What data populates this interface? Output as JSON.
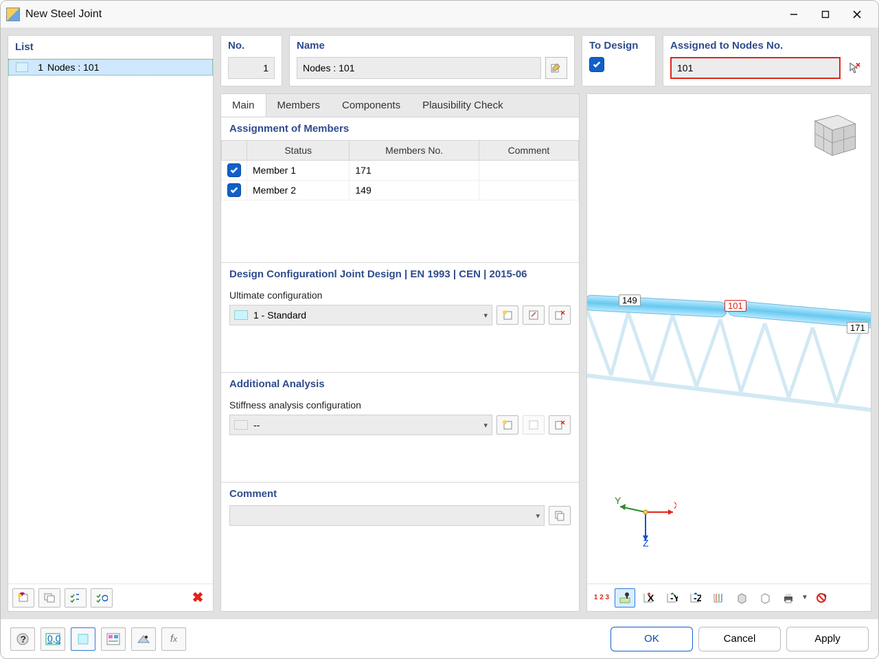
{
  "title": "New Steel Joint",
  "list": {
    "heading": "List",
    "items": [
      {
        "num": "1",
        "label": "Nodes : 101"
      }
    ]
  },
  "top": {
    "no_label": "No.",
    "no_value": "1",
    "name_label": "Name",
    "name_value": "Nodes : 101",
    "to_design_label": "To Design",
    "to_design_checked": true,
    "assigned_label": "Assigned to Nodes No.",
    "assigned_value": "101"
  },
  "tabs": [
    "Main",
    "Members",
    "Components",
    "Plausibility Check"
  ],
  "members": {
    "heading": "Assignment of Members",
    "cols": [
      "Status",
      "Members No.",
      "Comment"
    ],
    "rows": [
      {
        "checked": true,
        "status": "Member 1",
        "no": "171",
        "comment": ""
      },
      {
        "checked": true,
        "status": "Member 2",
        "no": "149",
        "comment": ""
      }
    ]
  },
  "design": {
    "heading": "Design Configurationl Joint Design | EN 1993 | CEN | 2015-06",
    "sublabel": "Ultimate configuration",
    "value": "1 - Standard"
  },
  "analysis": {
    "heading": "Additional Analysis",
    "sublabel": "Stiffness analysis configuration",
    "value": "--"
  },
  "comment": {
    "heading": "Comment",
    "value": ""
  },
  "preview": {
    "labels": [
      "149",
      "101",
      "171"
    ],
    "axes": [
      "X",
      "Y",
      "Z"
    ]
  },
  "footer": {
    "ok": "OK",
    "cancel": "Cancel",
    "apply": "Apply"
  }
}
